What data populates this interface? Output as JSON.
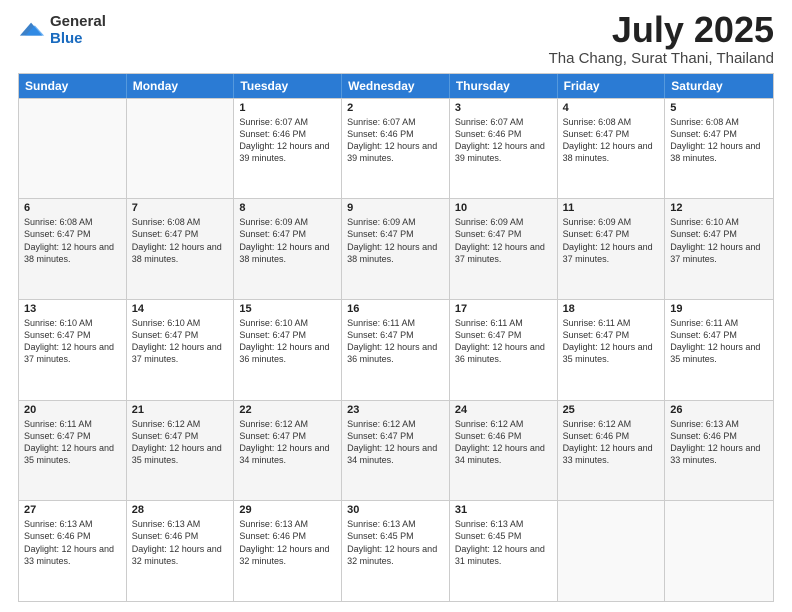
{
  "logo": {
    "general": "General",
    "blue": "Blue"
  },
  "title": {
    "month": "July 2025",
    "location": "Tha Chang, Surat Thani, Thailand"
  },
  "days": [
    "Sunday",
    "Monday",
    "Tuesday",
    "Wednesday",
    "Thursday",
    "Friday",
    "Saturday"
  ],
  "weeks": [
    [
      {
        "date": "",
        "sunrise": "",
        "sunset": "",
        "daylight": ""
      },
      {
        "date": "",
        "sunrise": "",
        "sunset": "",
        "daylight": ""
      },
      {
        "date": "1",
        "sunrise": "Sunrise: 6:07 AM",
        "sunset": "Sunset: 6:46 PM",
        "daylight": "Daylight: 12 hours and 39 minutes."
      },
      {
        "date": "2",
        "sunrise": "Sunrise: 6:07 AM",
        "sunset": "Sunset: 6:46 PM",
        "daylight": "Daylight: 12 hours and 39 minutes."
      },
      {
        "date": "3",
        "sunrise": "Sunrise: 6:07 AM",
        "sunset": "Sunset: 6:46 PM",
        "daylight": "Daylight: 12 hours and 39 minutes."
      },
      {
        "date": "4",
        "sunrise": "Sunrise: 6:08 AM",
        "sunset": "Sunset: 6:47 PM",
        "daylight": "Daylight: 12 hours and 38 minutes."
      },
      {
        "date": "5",
        "sunrise": "Sunrise: 6:08 AM",
        "sunset": "Sunset: 6:47 PM",
        "daylight": "Daylight: 12 hours and 38 minutes."
      }
    ],
    [
      {
        "date": "6",
        "sunrise": "Sunrise: 6:08 AM",
        "sunset": "Sunset: 6:47 PM",
        "daylight": "Daylight: 12 hours and 38 minutes."
      },
      {
        "date": "7",
        "sunrise": "Sunrise: 6:08 AM",
        "sunset": "Sunset: 6:47 PM",
        "daylight": "Daylight: 12 hours and 38 minutes."
      },
      {
        "date": "8",
        "sunrise": "Sunrise: 6:09 AM",
        "sunset": "Sunset: 6:47 PM",
        "daylight": "Daylight: 12 hours and 38 minutes."
      },
      {
        "date": "9",
        "sunrise": "Sunrise: 6:09 AM",
        "sunset": "Sunset: 6:47 PM",
        "daylight": "Daylight: 12 hours and 38 minutes."
      },
      {
        "date": "10",
        "sunrise": "Sunrise: 6:09 AM",
        "sunset": "Sunset: 6:47 PM",
        "daylight": "Daylight: 12 hours and 37 minutes."
      },
      {
        "date": "11",
        "sunrise": "Sunrise: 6:09 AM",
        "sunset": "Sunset: 6:47 PM",
        "daylight": "Daylight: 12 hours and 37 minutes."
      },
      {
        "date": "12",
        "sunrise": "Sunrise: 6:10 AM",
        "sunset": "Sunset: 6:47 PM",
        "daylight": "Daylight: 12 hours and 37 minutes."
      }
    ],
    [
      {
        "date": "13",
        "sunrise": "Sunrise: 6:10 AM",
        "sunset": "Sunset: 6:47 PM",
        "daylight": "Daylight: 12 hours and 37 minutes."
      },
      {
        "date": "14",
        "sunrise": "Sunrise: 6:10 AM",
        "sunset": "Sunset: 6:47 PM",
        "daylight": "Daylight: 12 hours and 37 minutes."
      },
      {
        "date": "15",
        "sunrise": "Sunrise: 6:10 AM",
        "sunset": "Sunset: 6:47 PM",
        "daylight": "Daylight: 12 hours and 36 minutes."
      },
      {
        "date": "16",
        "sunrise": "Sunrise: 6:11 AM",
        "sunset": "Sunset: 6:47 PM",
        "daylight": "Daylight: 12 hours and 36 minutes."
      },
      {
        "date": "17",
        "sunrise": "Sunrise: 6:11 AM",
        "sunset": "Sunset: 6:47 PM",
        "daylight": "Daylight: 12 hours and 36 minutes."
      },
      {
        "date": "18",
        "sunrise": "Sunrise: 6:11 AM",
        "sunset": "Sunset: 6:47 PM",
        "daylight": "Daylight: 12 hours and 35 minutes."
      },
      {
        "date": "19",
        "sunrise": "Sunrise: 6:11 AM",
        "sunset": "Sunset: 6:47 PM",
        "daylight": "Daylight: 12 hours and 35 minutes."
      }
    ],
    [
      {
        "date": "20",
        "sunrise": "Sunrise: 6:11 AM",
        "sunset": "Sunset: 6:47 PM",
        "daylight": "Daylight: 12 hours and 35 minutes."
      },
      {
        "date": "21",
        "sunrise": "Sunrise: 6:12 AM",
        "sunset": "Sunset: 6:47 PM",
        "daylight": "Daylight: 12 hours and 35 minutes."
      },
      {
        "date": "22",
        "sunrise": "Sunrise: 6:12 AM",
        "sunset": "Sunset: 6:47 PM",
        "daylight": "Daylight: 12 hours and 34 minutes."
      },
      {
        "date": "23",
        "sunrise": "Sunrise: 6:12 AM",
        "sunset": "Sunset: 6:47 PM",
        "daylight": "Daylight: 12 hours and 34 minutes."
      },
      {
        "date": "24",
        "sunrise": "Sunrise: 6:12 AM",
        "sunset": "Sunset: 6:46 PM",
        "daylight": "Daylight: 12 hours and 34 minutes."
      },
      {
        "date": "25",
        "sunrise": "Sunrise: 6:12 AM",
        "sunset": "Sunset: 6:46 PM",
        "daylight": "Daylight: 12 hours and 33 minutes."
      },
      {
        "date": "26",
        "sunrise": "Sunrise: 6:13 AM",
        "sunset": "Sunset: 6:46 PM",
        "daylight": "Daylight: 12 hours and 33 minutes."
      }
    ],
    [
      {
        "date": "27",
        "sunrise": "Sunrise: 6:13 AM",
        "sunset": "Sunset: 6:46 PM",
        "daylight": "Daylight: 12 hours and 33 minutes."
      },
      {
        "date": "28",
        "sunrise": "Sunrise: 6:13 AM",
        "sunset": "Sunset: 6:46 PM",
        "daylight": "Daylight: 12 hours and 32 minutes."
      },
      {
        "date": "29",
        "sunrise": "Sunrise: 6:13 AM",
        "sunset": "Sunset: 6:46 PM",
        "daylight": "Daylight: 12 hours and 32 minutes."
      },
      {
        "date": "30",
        "sunrise": "Sunrise: 6:13 AM",
        "sunset": "Sunset: 6:45 PM",
        "daylight": "Daylight: 12 hours and 32 minutes."
      },
      {
        "date": "31",
        "sunrise": "Sunrise: 6:13 AM",
        "sunset": "Sunset: 6:45 PM",
        "daylight": "Daylight: 12 hours and 31 minutes."
      },
      {
        "date": "",
        "sunrise": "",
        "sunset": "",
        "daylight": ""
      },
      {
        "date": "",
        "sunrise": "",
        "sunset": "",
        "daylight": ""
      }
    ]
  ]
}
